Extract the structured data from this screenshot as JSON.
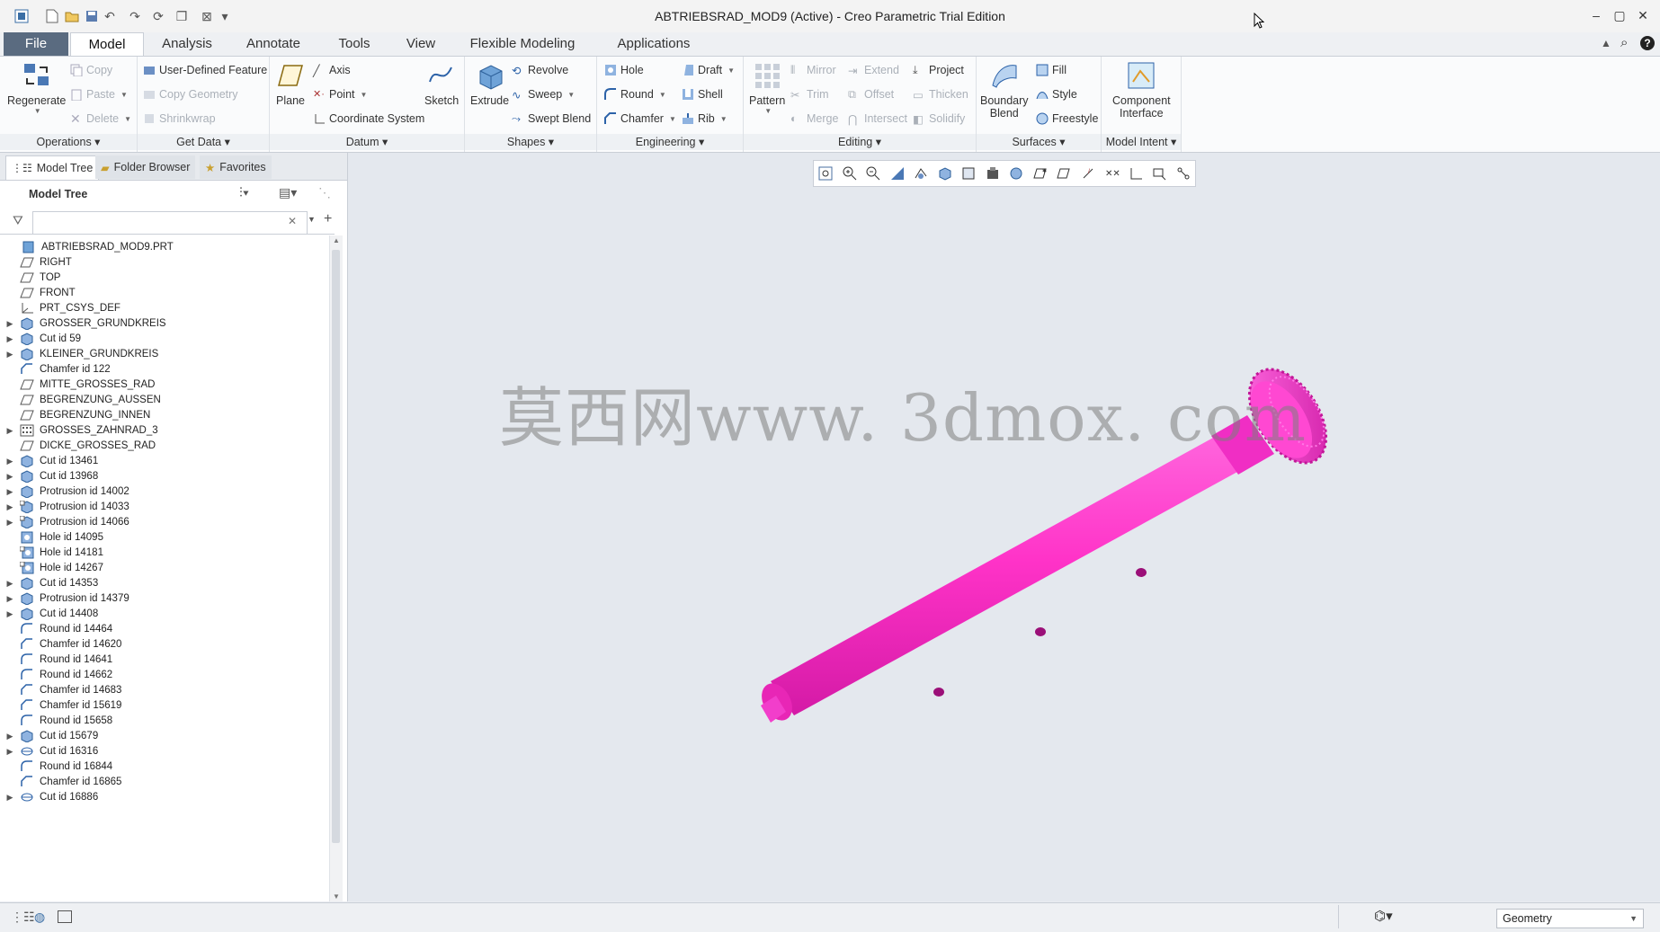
{
  "window": {
    "title": "ABTRIEBSRAD_MOD9 (Active) - Creo Parametric Trial Edition"
  },
  "tabs": [
    {
      "label": "File"
    },
    {
      "label": "Model"
    },
    {
      "label": "Analysis"
    },
    {
      "label": "Annotate"
    },
    {
      "label": "Tools"
    },
    {
      "label": "View"
    },
    {
      "label": "Flexible Modeling"
    },
    {
      "label": "Applications"
    }
  ],
  "ribbon": {
    "operations": {
      "label": "Operations",
      "regenerate": "Regenerate",
      "copy": "Copy",
      "paste": "Paste",
      "delete": "Delete"
    },
    "get_data": {
      "label": "Get Data",
      "udf": "User-Defined Feature",
      "copy_geometry": "Copy Geometry",
      "shrinkwrap": "Shrinkwrap"
    },
    "datum": {
      "label": "Datum",
      "plane": "Plane",
      "axis": "Axis",
      "point": "Point",
      "csys": "Coordinate System",
      "sketch": "Sketch"
    },
    "shapes": {
      "label": "Shapes",
      "extrude": "Extrude",
      "revolve": "Revolve",
      "sweep": "Sweep",
      "swept_blend": "Swept Blend"
    },
    "engineering": {
      "label": "Engineering",
      "hole": "Hole",
      "round": "Round",
      "chamfer": "Chamfer",
      "draft": "Draft",
      "shell": "Shell",
      "rib": "Rib"
    },
    "editing": {
      "label": "Editing",
      "pattern": "Pattern",
      "mirror": "Mirror",
      "trim": "Trim",
      "merge": "Merge",
      "extend": "Extend",
      "offset": "Offset",
      "intersect": "Intersect",
      "project": "Project",
      "thicken": "Thicken",
      "solidify": "Solidify"
    },
    "surfaces": {
      "label": "Surfaces",
      "boundary_blend_1": "Boundary",
      "boundary_blend_2": "Blend",
      "fill": "Fill",
      "style": "Style",
      "freestyle": "Freestyle"
    },
    "model_intent": {
      "label": "Model Intent",
      "component_interface_1": "Component",
      "component_interface_2": "Interface"
    }
  },
  "panel": {
    "tabs": [
      {
        "label": "Model Tree"
      },
      {
        "label": "Folder Browser"
      },
      {
        "label": "Favorites"
      }
    ],
    "tree_title": "Model Tree",
    "search_value": ""
  },
  "tree": [
    {
      "label": "ABTRIEBSRAD_MOD9.PRT",
      "icon": "part",
      "exp": false,
      "indent": 0
    },
    {
      "label": "RIGHT",
      "icon": "plane",
      "exp": false,
      "indent": 1
    },
    {
      "label": "TOP",
      "icon": "plane",
      "exp": false,
      "indent": 1
    },
    {
      "label": "FRONT",
      "icon": "plane",
      "exp": false,
      "indent": 1
    },
    {
      "label": "PRT_CSYS_DEF",
      "icon": "csys",
      "exp": false,
      "indent": 1
    },
    {
      "label": "GROSSER_GRUNDKREIS",
      "icon": "extrude",
      "exp": true,
      "indent": 1
    },
    {
      "label": "Cut id 59",
      "icon": "extrude",
      "exp": true,
      "indent": 1
    },
    {
      "label": "KLEINER_GRUNDKREIS",
      "icon": "extrude",
      "exp": true,
      "indent": 1
    },
    {
      "label": "Chamfer id 122",
      "icon": "chamfer",
      "exp": false,
      "indent": 1
    },
    {
      "label": "MITTE_GROSSES_RAD",
      "icon": "plane",
      "exp": false,
      "indent": 1
    },
    {
      "label": "BEGRENZUNG_AUSSEN",
      "icon": "plane",
      "exp": false,
      "indent": 1
    },
    {
      "label": "BEGRENZUNG_INNEN",
      "icon": "plane",
      "exp": false,
      "indent": 1
    },
    {
      "label": "GROSSES_ZAHNRAD_3",
      "icon": "pattern",
      "exp": true,
      "indent": 1
    },
    {
      "label": "DICKE_GROSSES_RAD",
      "icon": "plane",
      "exp": false,
      "indent": 1
    },
    {
      "label": "Cut id 13461",
      "icon": "extrude",
      "exp": true,
      "indent": 1
    },
    {
      "label": "Cut id 13968",
      "icon": "extrude",
      "exp": true,
      "indent": 1
    },
    {
      "label": "Protrusion id 14002",
      "icon": "extrude",
      "exp": true,
      "indent": 1
    },
    {
      "label": "Protrusion id 14033",
      "icon": "extrude-link",
      "exp": true,
      "indent": 1
    },
    {
      "label": "Protrusion id 14066",
      "icon": "extrude-link",
      "exp": true,
      "indent": 1
    },
    {
      "label": "Hole id 14095",
      "icon": "hole",
      "exp": false,
      "indent": 1
    },
    {
      "label": "Hole id 14181",
      "icon": "hole-link",
      "exp": false,
      "indent": 1
    },
    {
      "label": "Hole id 14267",
      "icon": "hole-link",
      "exp": false,
      "indent": 1
    },
    {
      "label": "Cut id 14353",
      "icon": "extrude",
      "exp": true,
      "indent": 1
    },
    {
      "label": "Protrusion id 14379",
      "icon": "extrude",
      "exp": true,
      "indent": 1
    },
    {
      "label": "Cut id 14408",
      "icon": "extrude",
      "exp": true,
      "indent": 1
    },
    {
      "label": "Round id 14464",
      "icon": "round",
      "exp": false,
      "indent": 1
    },
    {
      "label": "Chamfer id 14620",
      "icon": "chamfer",
      "exp": false,
      "indent": 1
    },
    {
      "label": "Round id 14641",
      "icon": "round",
      "exp": false,
      "indent": 1
    },
    {
      "label": "Round id 14662",
      "icon": "round",
      "exp": false,
      "indent": 1
    },
    {
      "label": "Chamfer id 14683",
      "icon": "chamfer",
      "exp": false,
      "indent": 1
    },
    {
      "label": "Chamfer id 15619",
      "icon": "chamfer",
      "exp": false,
      "indent": 1
    },
    {
      "label": "Round id 15658",
      "icon": "round",
      "exp": false,
      "indent": 1
    },
    {
      "label": "Cut id 15679",
      "icon": "extrude",
      "exp": true,
      "indent": 1
    },
    {
      "label": "Cut id 16316",
      "icon": "revolve",
      "exp": true,
      "indent": 1
    },
    {
      "label": "Round id 16844",
      "icon": "round",
      "exp": false,
      "indent": 1
    },
    {
      "label": "Chamfer id 16865",
      "icon": "chamfer",
      "exp": false,
      "indent": 1
    },
    {
      "label": "Cut id 16886",
      "icon": "revolve",
      "exp": true,
      "indent": 1
    }
  ],
  "graphics": {
    "watermark": "莫西网www. 3dmox. com",
    "model_color": "#ff33c8"
  },
  "status": {
    "filter_value": "Geometry"
  }
}
